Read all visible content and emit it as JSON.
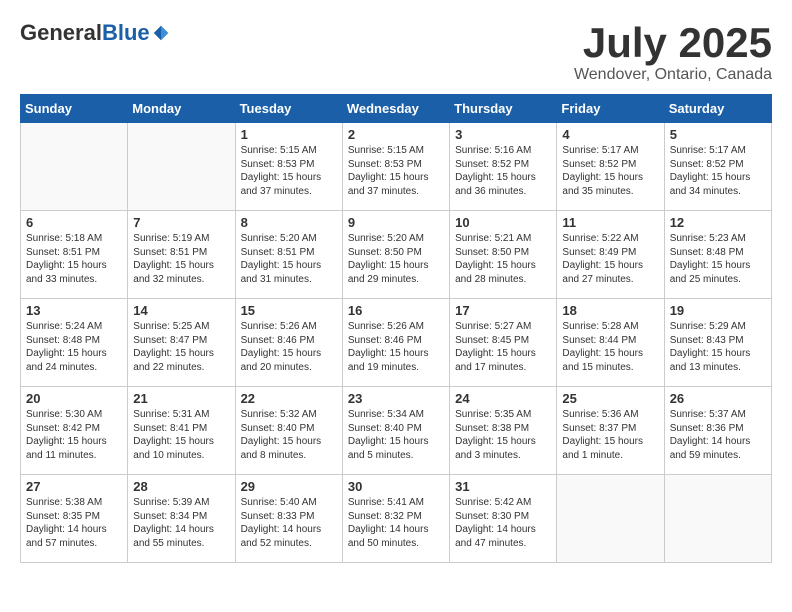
{
  "header": {
    "logo_general": "General",
    "logo_blue": "Blue",
    "month_title": "July 2025",
    "location": "Wendover, Ontario, Canada"
  },
  "days_of_week": [
    "Sunday",
    "Monday",
    "Tuesday",
    "Wednesday",
    "Thursday",
    "Friday",
    "Saturday"
  ],
  "weeks": [
    [
      {
        "day": "",
        "content": ""
      },
      {
        "day": "",
        "content": ""
      },
      {
        "day": "1",
        "content": "Sunrise: 5:15 AM\nSunset: 8:53 PM\nDaylight: 15 hours and 37 minutes."
      },
      {
        "day": "2",
        "content": "Sunrise: 5:15 AM\nSunset: 8:53 PM\nDaylight: 15 hours and 37 minutes."
      },
      {
        "day": "3",
        "content": "Sunrise: 5:16 AM\nSunset: 8:52 PM\nDaylight: 15 hours and 36 minutes."
      },
      {
        "day": "4",
        "content": "Sunrise: 5:17 AM\nSunset: 8:52 PM\nDaylight: 15 hours and 35 minutes."
      },
      {
        "day": "5",
        "content": "Sunrise: 5:17 AM\nSunset: 8:52 PM\nDaylight: 15 hours and 34 minutes."
      }
    ],
    [
      {
        "day": "6",
        "content": "Sunrise: 5:18 AM\nSunset: 8:51 PM\nDaylight: 15 hours and 33 minutes."
      },
      {
        "day": "7",
        "content": "Sunrise: 5:19 AM\nSunset: 8:51 PM\nDaylight: 15 hours and 32 minutes."
      },
      {
        "day": "8",
        "content": "Sunrise: 5:20 AM\nSunset: 8:51 PM\nDaylight: 15 hours and 31 minutes."
      },
      {
        "day": "9",
        "content": "Sunrise: 5:20 AM\nSunset: 8:50 PM\nDaylight: 15 hours and 29 minutes."
      },
      {
        "day": "10",
        "content": "Sunrise: 5:21 AM\nSunset: 8:50 PM\nDaylight: 15 hours and 28 minutes."
      },
      {
        "day": "11",
        "content": "Sunrise: 5:22 AM\nSunset: 8:49 PM\nDaylight: 15 hours and 27 minutes."
      },
      {
        "day": "12",
        "content": "Sunrise: 5:23 AM\nSunset: 8:48 PM\nDaylight: 15 hours and 25 minutes."
      }
    ],
    [
      {
        "day": "13",
        "content": "Sunrise: 5:24 AM\nSunset: 8:48 PM\nDaylight: 15 hours and 24 minutes."
      },
      {
        "day": "14",
        "content": "Sunrise: 5:25 AM\nSunset: 8:47 PM\nDaylight: 15 hours and 22 minutes."
      },
      {
        "day": "15",
        "content": "Sunrise: 5:26 AM\nSunset: 8:46 PM\nDaylight: 15 hours and 20 minutes."
      },
      {
        "day": "16",
        "content": "Sunrise: 5:26 AM\nSunset: 8:46 PM\nDaylight: 15 hours and 19 minutes."
      },
      {
        "day": "17",
        "content": "Sunrise: 5:27 AM\nSunset: 8:45 PM\nDaylight: 15 hours and 17 minutes."
      },
      {
        "day": "18",
        "content": "Sunrise: 5:28 AM\nSunset: 8:44 PM\nDaylight: 15 hours and 15 minutes."
      },
      {
        "day": "19",
        "content": "Sunrise: 5:29 AM\nSunset: 8:43 PM\nDaylight: 15 hours and 13 minutes."
      }
    ],
    [
      {
        "day": "20",
        "content": "Sunrise: 5:30 AM\nSunset: 8:42 PM\nDaylight: 15 hours and 11 minutes."
      },
      {
        "day": "21",
        "content": "Sunrise: 5:31 AM\nSunset: 8:41 PM\nDaylight: 15 hours and 10 minutes."
      },
      {
        "day": "22",
        "content": "Sunrise: 5:32 AM\nSunset: 8:40 PM\nDaylight: 15 hours and 8 minutes."
      },
      {
        "day": "23",
        "content": "Sunrise: 5:34 AM\nSunset: 8:40 PM\nDaylight: 15 hours and 5 minutes."
      },
      {
        "day": "24",
        "content": "Sunrise: 5:35 AM\nSunset: 8:38 PM\nDaylight: 15 hours and 3 minutes."
      },
      {
        "day": "25",
        "content": "Sunrise: 5:36 AM\nSunset: 8:37 PM\nDaylight: 15 hours and 1 minute."
      },
      {
        "day": "26",
        "content": "Sunrise: 5:37 AM\nSunset: 8:36 PM\nDaylight: 14 hours and 59 minutes."
      }
    ],
    [
      {
        "day": "27",
        "content": "Sunrise: 5:38 AM\nSunset: 8:35 PM\nDaylight: 14 hours and 57 minutes."
      },
      {
        "day": "28",
        "content": "Sunrise: 5:39 AM\nSunset: 8:34 PM\nDaylight: 14 hours and 55 minutes."
      },
      {
        "day": "29",
        "content": "Sunrise: 5:40 AM\nSunset: 8:33 PM\nDaylight: 14 hours and 52 minutes."
      },
      {
        "day": "30",
        "content": "Sunrise: 5:41 AM\nSunset: 8:32 PM\nDaylight: 14 hours and 50 minutes."
      },
      {
        "day": "31",
        "content": "Sunrise: 5:42 AM\nSunset: 8:30 PM\nDaylight: 14 hours and 47 minutes."
      },
      {
        "day": "",
        "content": ""
      },
      {
        "day": "",
        "content": ""
      }
    ]
  ]
}
